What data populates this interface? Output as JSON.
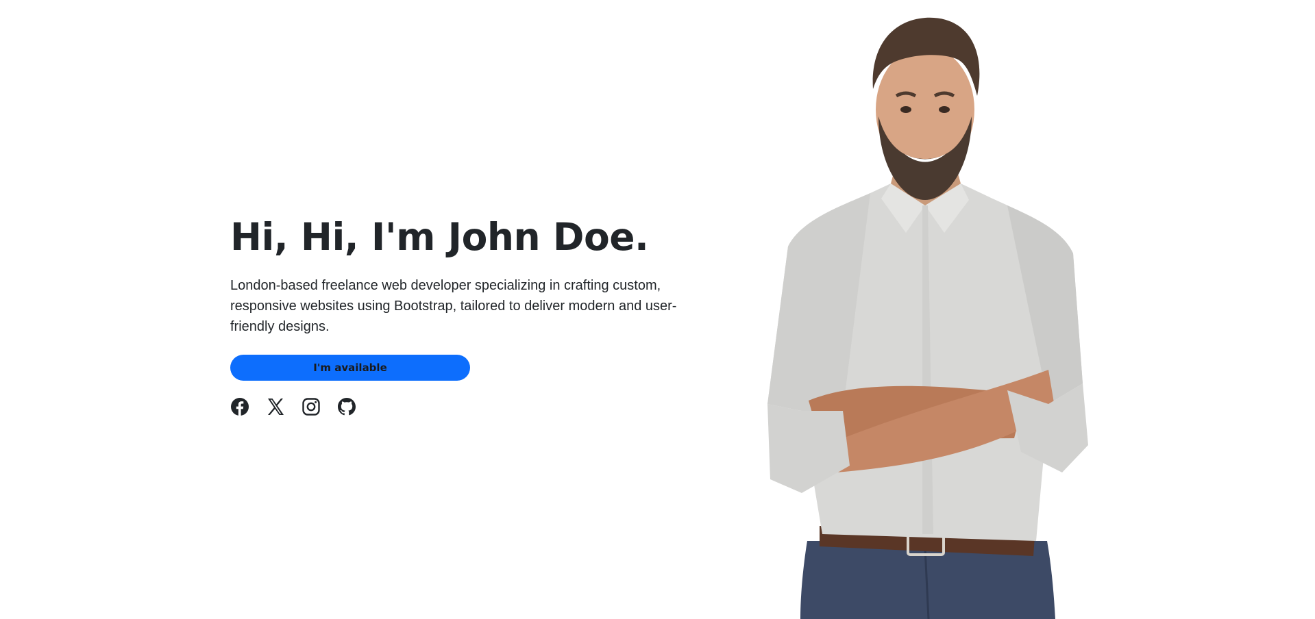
{
  "hero": {
    "title": "Hi, Hi, I'm John Doe.",
    "description": "London-based freelance web developer specializing in crafting custom, responsive websites using Bootstrap, tailored to deliver modern and user-friendly designs.",
    "cta_label": "I'm available",
    "accent_color": "#0d6efd"
  },
  "social": [
    {
      "icon": "facebook-icon"
    },
    {
      "icon": "x-twitter-icon"
    },
    {
      "icon": "instagram-icon"
    },
    {
      "icon": "github-icon"
    }
  ],
  "portrait": {
    "subject": "smiling man with arms crossed, light grey shirt, brown belt, navy trousers"
  }
}
